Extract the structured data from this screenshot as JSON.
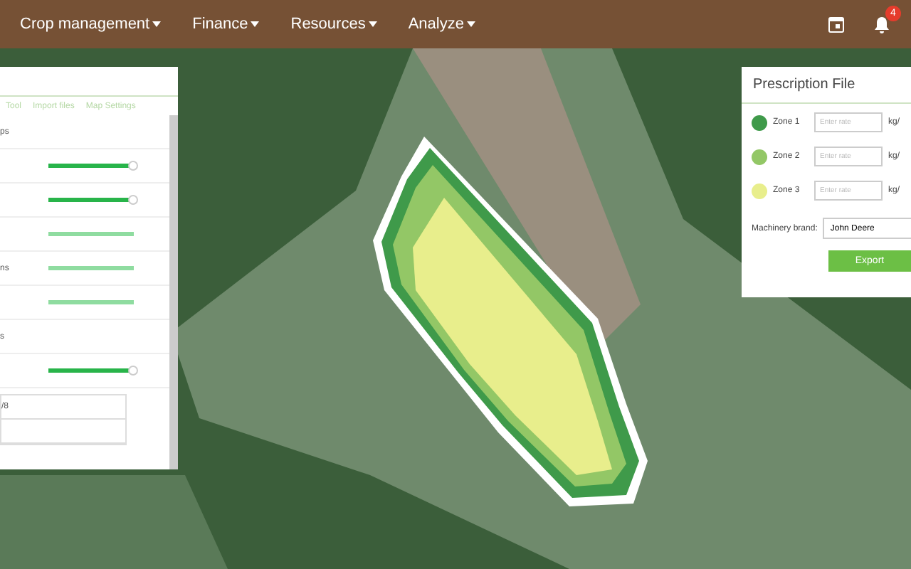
{
  "nav": {
    "menus": [
      {
        "label": "Crop management"
      },
      {
        "label": "Finance"
      },
      {
        "label": "Resources"
      },
      {
        "label": "Analyze"
      }
    ],
    "notifications": "4"
  },
  "left_panel": {
    "tabs": [
      {
        "label": "Tool",
        "selected": false
      },
      {
        "label": "Import files",
        "selected": false
      },
      {
        "label": "Map Settings",
        "selected": false
      }
    ],
    "rows": [
      {
        "kind": "header",
        "label": "ps"
      },
      {
        "kind": "slider",
        "label": "",
        "active": true,
        "level": 1
      },
      {
        "kind": "slider",
        "label": "",
        "active": true,
        "level": 1
      },
      {
        "kind": "slider",
        "label": "",
        "active": false,
        "level": 1
      },
      {
        "kind": "slider",
        "label": "ns",
        "active": false,
        "level": 1
      },
      {
        "kind": "slider",
        "label": "",
        "active": false,
        "level": 1
      },
      {
        "kind": "header",
        "label": "s"
      },
      {
        "kind": "slider",
        "label": "",
        "active": true,
        "level": 1
      }
    ],
    "list": [
      "/8"
    ]
  },
  "prescription": {
    "title": "Prescription File",
    "zones": [
      {
        "name": "Zone 1",
        "color": "#3f9a4a",
        "placeholder": "Enter rate",
        "unit": "kg/"
      },
      {
        "name": "Zone 2",
        "color": "#93c766",
        "placeholder": "Enter rate",
        "unit": "kg/"
      },
      {
        "name": "Zone 3",
        "color": "#e8ee8c",
        "placeholder": "Enter rate",
        "unit": "kg/"
      }
    ],
    "machinery_label": "Machinery brand:",
    "machinery_value": "John Deere",
    "export": "Export"
  }
}
